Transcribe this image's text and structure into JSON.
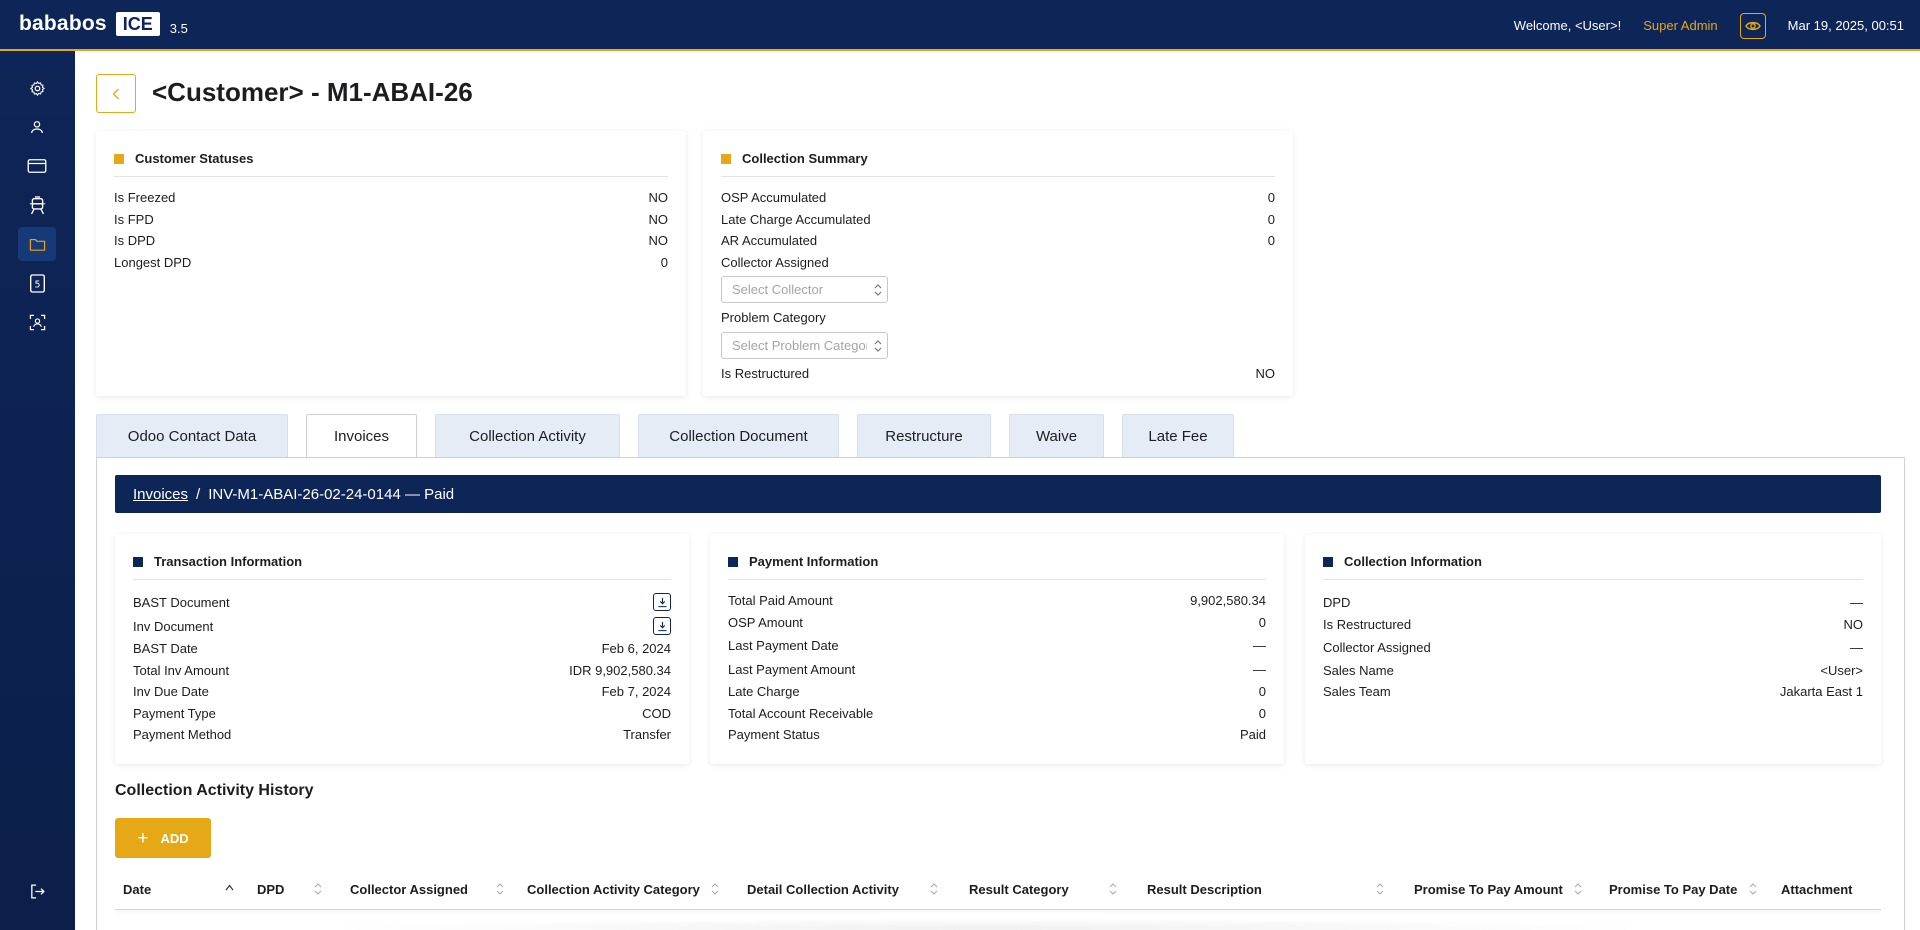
{
  "header": {
    "logo_text": "bababos",
    "logo_badge": "ICE",
    "version": "3.5",
    "welcome": "Welcome, <User>!",
    "role": "Super Admin",
    "datetime": "Mar 19, 2025, 00:51"
  },
  "sidebar": {
    "items": [
      {
        "icon": "settings-icon",
        "active": false
      },
      {
        "icon": "user-icon",
        "active": false
      },
      {
        "icon": "card-icon",
        "active": false
      },
      {
        "icon": "tram-icon",
        "active": false
      },
      {
        "icon": "folder-icon",
        "active": true
      },
      {
        "icon": "number-five-icon",
        "active": false,
        "glyph": "5"
      },
      {
        "icon": "face-scan-icon",
        "active": false
      },
      {
        "icon": "logout-icon",
        "active": false
      }
    ]
  },
  "page": {
    "title": "<Customer> - M1-ABAI-26"
  },
  "customer_statuses": {
    "title": "Customer Statuses",
    "rows": [
      {
        "label": "Is Freezed",
        "value": "NO"
      },
      {
        "label": "Is FPD",
        "value": "NO"
      },
      {
        "label": "Is DPD",
        "value": "NO"
      },
      {
        "label": "Longest DPD",
        "value": "0"
      }
    ]
  },
  "collection_summary": {
    "title": "Collection Summary",
    "rows": [
      {
        "label": "OSP Accumulated",
        "value": "0"
      },
      {
        "label": "Late Charge Accumulated",
        "value": "0"
      },
      {
        "label": "AR Accumulated",
        "value": "0"
      }
    ],
    "collector_label": "Collector Assigned",
    "collector_placeholder": "Select Collector",
    "problem_label": "Problem Category",
    "problem_placeholder": "Select Problem Category",
    "restructured_label": "Is Restructured",
    "restructured_value": "NO"
  },
  "tabs": [
    {
      "label": "Odoo Contact Data",
      "active": false
    },
    {
      "label": "Invoices",
      "active": true
    },
    {
      "label": "Collection Activity",
      "active": false
    },
    {
      "label": "Collection Document",
      "active": false
    },
    {
      "label": "Restructure",
      "active": false
    },
    {
      "label": "Waive",
      "active": false
    },
    {
      "label": "Late Fee",
      "active": false
    }
  ],
  "breadcrumb": {
    "link": "Invoices",
    "separator": "/",
    "current": "INV-M1-ABAI-26-02-24-0144 — Paid"
  },
  "transaction_info": {
    "title": "Transaction Information",
    "bast_document_label": "BAST Document",
    "inv_document_label": "Inv Document",
    "rows": [
      {
        "label": "BAST Date",
        "value": "Feb 6, 2024"
      },
      {
        "label": "Total Inv Amount",
        "value": "IDR 9,902,580.34"
      },
      {
        "label": "Inv Due Date",
        "value": "Feb 7, 2024"
      },
      {
        "label": "Payment Type",
        "value": "COD"
      },
      {
        "label": "Payment Method",
        "value": "Transfer"
      }
    ]
  },
  "payment_info": {
    "title": "Payment Information",
    "rows": [
      {
        "label": "Total Paid Amount",
        "value": "9,902,580.34"
      },
      {
        "label": "OSP Amount",
        "value": "0"
      },
      {
        "label": "Last Payment Date",
        "value": "—"
      },
      {
        "label": "Last Payment Amount",
        "value": "—"
      },
      {
        "label": "Late Charge",
        "value": "0"
      },
      {
        "label": "Total Account Receivable",
        "value": "0"
      },
      {
        "label": "Payment Status",
        "value": "Paid"
      }
    ]
  },
  "collection_info": {
    "title": "Collection Information",
    "rows": [
      {
        "label": "DPD",
        "value": "—"
      },
      {
        "label": "Is Restructured",
        "value": "NO"
      },
      {
        "label": "Collector Assigned",
        "value": "—"
      },
      {
        "label": "Sales Name",
        "value": "<User>"
      },
      {
        "label": "Sales Team",
        "value": "Jakarta East 1"
      }
    ]
  },
  "activity_history": {
    "title": "Collection Activity History",
    "add_label": "ADD",
    "columns": [
      "Date",
      "DPD",
      "Collector Assigned",
      "Collection Activity Category",
      "Detail Collection Activity",
      "Result Category",
      "Result Description",
      "Promise To Pay Amount",
      "Promise To Pay Date",
      "Attachment"
    ]
  },
  "colors": {
    "navy": "#0e2557",
    "gold": "#e6a817",
    "tab_bg": "#e6ecf6"
  }
}
